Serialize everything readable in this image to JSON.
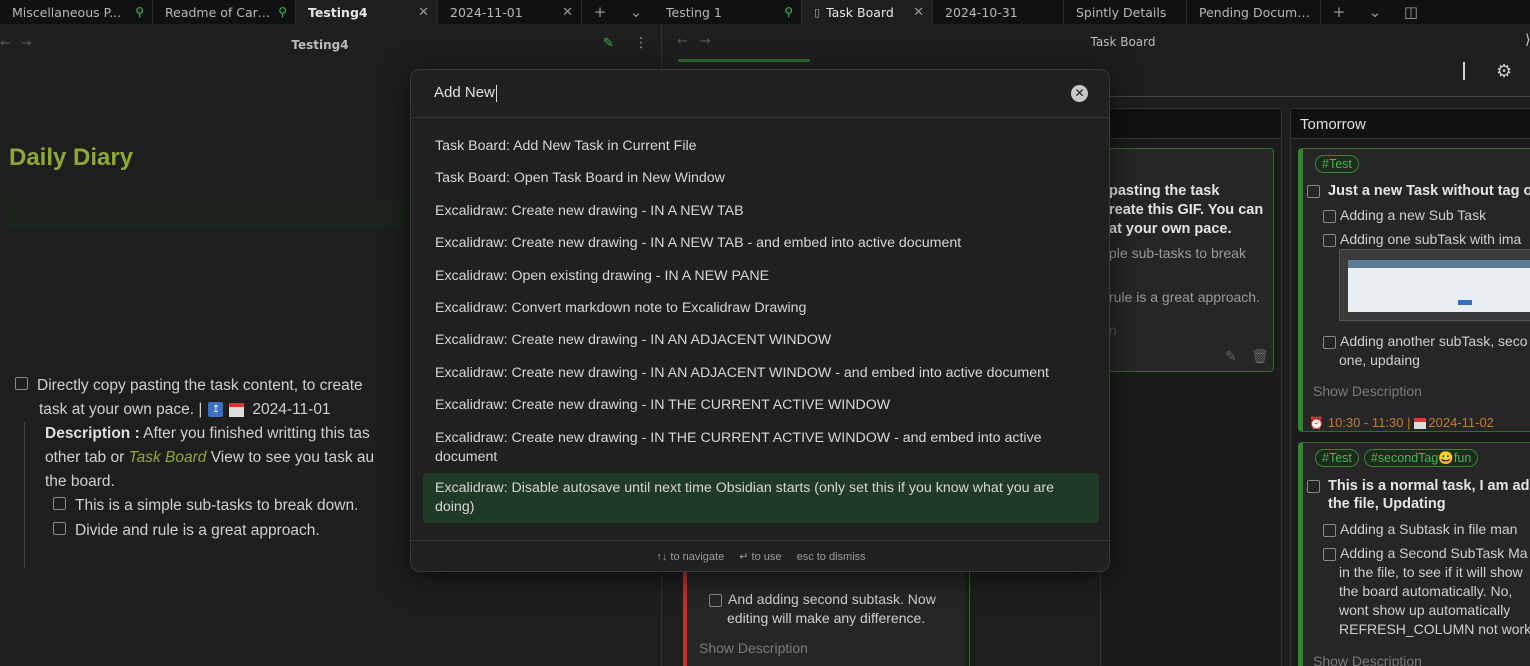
{
  "tabs_left": [
    {
      "label": "Miscellaneous P...",
      "icon": "pin-icon"
    },
    {
      "label": "Readme of Card...",
      "icon": "pin-icon"
    },
    {
      "label": "Testing4",
      "icon": "close-icon",
      "active": true
    },
    {
      "label": "2024-11-01",
      "icon": "close-icon"
    }
  ],
  "tabs_right": [
    {
      "label": "Testing 1",
      "icon": "pin-icon"
    },
    {
      "label": "Task Board",
      "icon": "close-icon",
      "active": true
    },
    {
      "label": "2024-10-31"
    },
    {
      "label": "Spintly Details"
    },
    {
      "label": "Pending Documen..."
    }
  ],
  "left_pane": {
    "title": "Testing4",
    "heading": "Daily Diary",
    "task_line1": "Directly copy pasting the task content, to create",
    "task_line2_a": "task at your own pace. |",
    "task_date": "2024-11-01",
    "desc_label": "Description :",
    "desc_line1": " After you finished writting this tas",
    "desc_line2_a": "other tab or ",
    "desc_link": "Task Board",
    "desc_line2_b": " View to see you task au",
    "desc_line3": "the board.",
    "subtasks": [
      "This is a simple sub-tasks to break down.",
      "Divide and rule is a great approach."
    ]
  },
  "right_pane": {
    "title": "Task Board",
    "columns": [
      {
        "name": "Tomorrow"
      }
    ],
    "card_mid": {
      "lines": [
        "pasting the task",
        "reate this GIF. You can",
        "at your own pace."
      ],
      "sub1": "ple sub-tasks to break",
      "sub2": "rule is a great approach.",
      "trunc": "n"
    },
    "card_tomorrow1": {
      "tag": "#Test",
      "title": "Just a new Task without tag or",
      "subs": [
        "Adding a new Sub Task",
        "Adding one subTask with ima"
      ],
      "sub3_a": "Adding another subTask, seco",
      "sub3_b": "one, updaing",
      "show_desc": "Show Description",
      "time": "10:30 - 11:30 |",
      "date": "2024-11-02"
    },
    "card_tomorrow2": {
      "tags": [
        "#Test",
        "#secondTag"
      ],
      "tag_suffix": "fun",
      "title_a": "This is a normal task, I am add",
      "title_b": "the file, Updating",
      "sub1": "Adding a Subtask in file man",
      "sub2_lines": [
        "Adding a Second SubTask Ma",
        "in the file, to see if it will show",
        "the board automatically. No,",
        "wont show up automatically",
        "REFRESH_COLUMN not worki"
      ],
      "show_desc": "Show Description"
    },
    "card_red": {
      "sub_a": "And adding second subtask. Now",
      "sub_b": "editing will make any difference.",
      "show_desc": "Show Description"
    }
  },
  "palette": {
    "query": "Add New",
    "items": [
      "Task Board: Add New Task in Current File",
      "Task Board: Open Task Board in New Window",
      "Excalidraw: Create new drawing - IN A NEW TAB",
      "Excalidraw: Create new drawing - IN A NEW TAB - and embed into active document",
      "Excalidraw: Open existing drawing - IN A NEW PANE",
      "Excalidraw: Convert markdown note to Excalidraw Drawing",
      "Excalidraw: Create new drawing - IN AN ADJACENT WINDOW",
      "Excalidraw: Create new drawing - IN AN ADJACENT WINDOW - and embed into active document",
      "Excalidraw: Create new drawing - IN THE CURRENT ACTIVE WINDOW",
      "Excalidraw: Create new drawing - IN THE CURRENT ACTIVE WINDOW - and embed into active document",
      "Excalidraw: Disable autosave until next time Obsidian starts (only set this if you know what you are doing)"
    ],
    "footer": [
      "↑↓ to navigate",
      "↵ to use",
      "esc to dismiss"
    ]
  },
  "colors": {
    "accent": "#3fb950",
    "heading": "#8ea834",
    "selected": "#1f3a25"
  }
}
